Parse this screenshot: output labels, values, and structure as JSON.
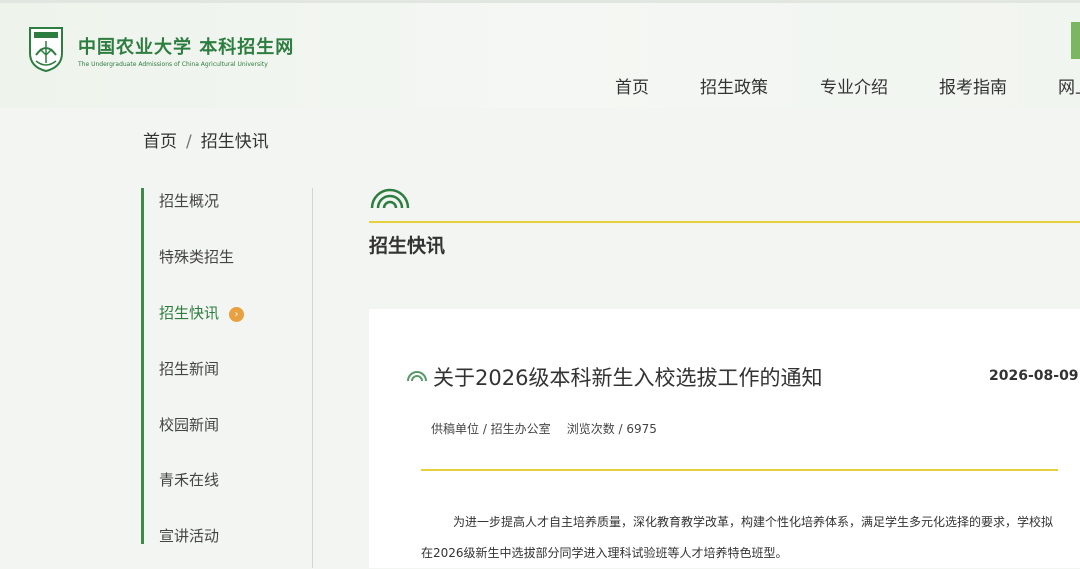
{
  "header": {
    "site_name": "中国农业大学 本科招生网",
    "site_subtitle": "The Undergraduate Admissions of China Agricultural University",
    "nav": [
      "首页",
      "招生政策",
      "专业介绍",
      "报考指南",
      "网上"
    ]
  },
  "breadcrumb": {
    "home": "首页",
    "separator": "/",
    "current": "招生快讯"
  },
  "sidebar": {
    "items": [
      "招生概况",
      "特殊类招生",
      "招生快讯",
      "招生新闻",
      "校园新闻",
      "青禾在线",
      "宣讲活动"
    ],
    "active_index": 2
  },
  "section": {
    "title": "招生快讯"
  },
  "article": {
    "title": "关于2026级本科新生入校选拔工作的通知",
    "date": "2026-08-09",
    "source_label": "供稿单位 / 招生办公室",
    "views_label": "浏览次数 / 6975",
    "body": "为进一步提高人才自主培养质量，深化教育教学改革，构建个性化培养体系，满足学生多元化选择的要求，学校拟在2026级新生中选拔部分同学进入理科试验班等人才培养特色班型。"
  },
  "colors": {
    "brand_green": "#2e7d40",
    "accent_yellow": "#e8cf3e",
    "badge_orange": "#e8a040"
  }
}
